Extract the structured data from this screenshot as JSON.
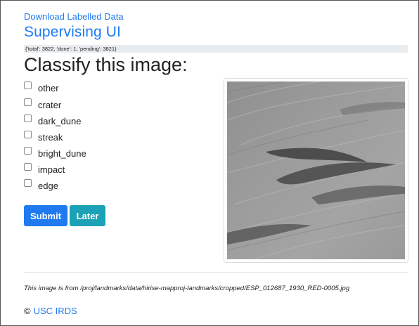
{
  "header": {
    "download_link": "Download Labelled Data",
    "title": "Supervising UI"
  },
  "stats_text": "{'total': 3822, 'done': 1, 'pending': 3821}",
  "heading": "Classify this image:",
  "options": [
    {
      "label": "other",
      "checked": false
    },
    {
      "label": "crater",
      "checked": false
    },
    {
      "label": "dark_dune",
      "checked": false
    },
    {
      "label": "streak",
      "checked": false
    },
    {
      "label": "bright_dune",
      "checked": false
    },
    {
      "label": "impact",
      "checked": false
    },
    {
      "label": "edge",
      "checked": false
    }
  ],
  "buttons": {
    "submit_label": "Submit",
    "later_label": "Later"
  },
  "image_source": "This image is from /proj/landmarks/data/hirise-mapproj-landmarks/cropped/ESP_012687_1930_RED-0005.jpg",
  "footer": {
    "copyright_symbol": "©",
    "org_link": "USC IRDS"
  },
  "colors": {
    "link": "#1f7af0",
    "submit": "#1f7af0",
    "later": "#1ca2b6"
  }
}
